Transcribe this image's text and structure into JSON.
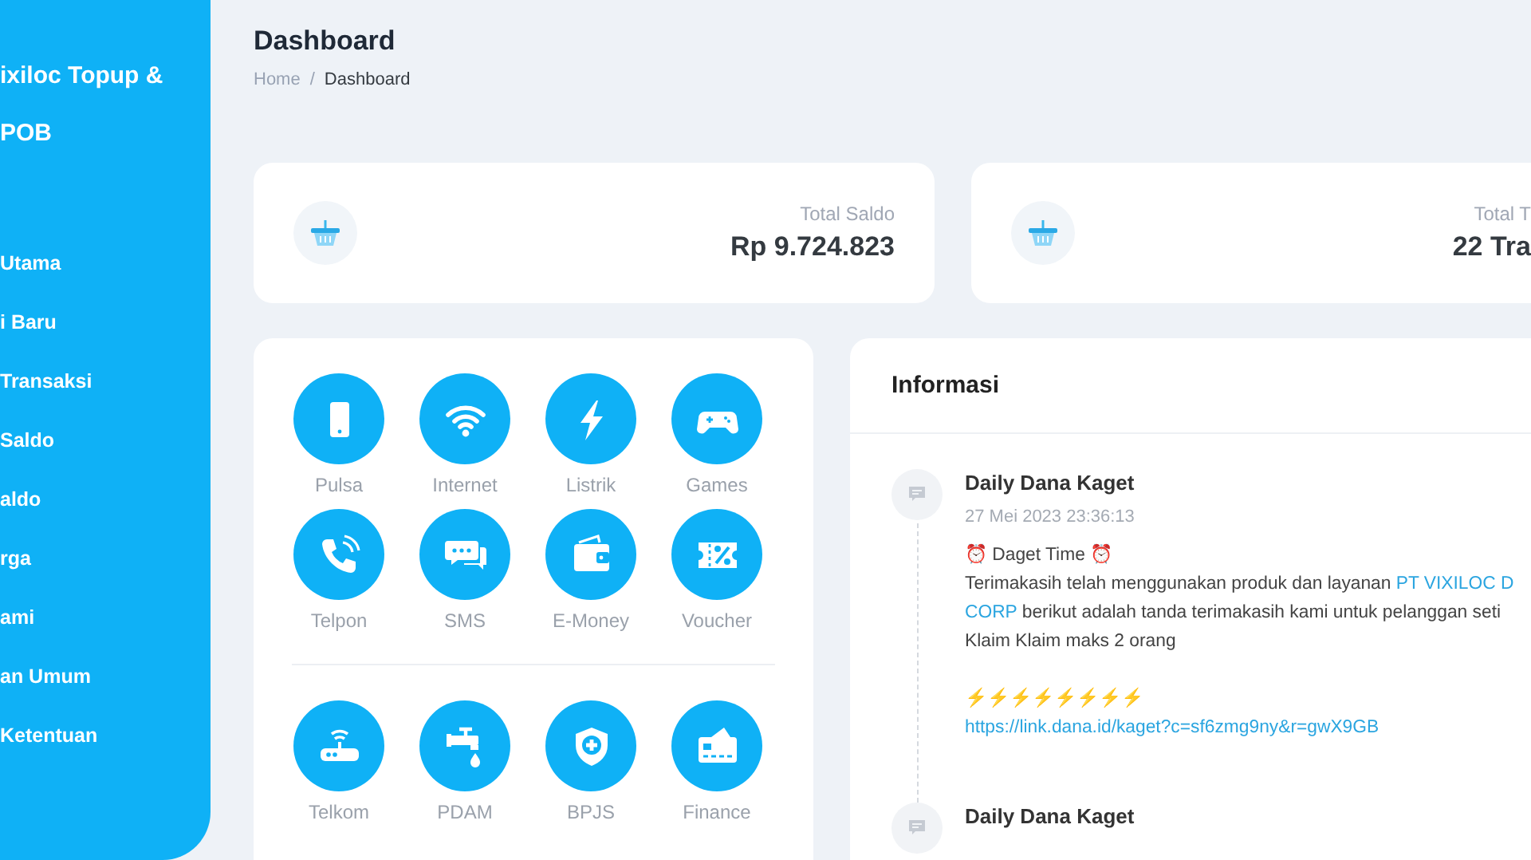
{
  "sidebar": {
    "brand_lines": [
      "ixiloc Topup &",
      "POB"
    ],
    "items": [
      "Utama",
      "i Baru",
      "Transaksi",
      "Saldo",
      "aldo",
      "rga",
      "ami",
      "an Umum",
      "Ketentuan"
    ]
  },
  "header": {
    "title": "Dashboard",
    "separator": "/",
    "breadcrumb": [
      {
        "label": "Home",
        "selected": false
      },
      {
        "label": "Dashboard",
        "selected": true
      }
    ]
  },
  "stats": [
    {
      "label": "Total Saldo",
      "value": "Rp 9.724.823"
    },
    {
      "label": "Total T",
      "value": "22 Tra"
    }
  ],
  "services": {
    "groups": [
      [
        "Pulsa",
        "Internet",
        "Listrik",
        "Games",
        "Telpon",
        "SMS",
        "E-Money",
        "Voucher"
      ],
      [
        "Telkom",
        "PDAM",
        "BPJS",
        "Finance"
      ]
    ]
  },
  "info": {
    "title": "Informasi",
    "posts": [
      {
        "title": "Daily Dana Kaget",
        "date": "27 Mei 2023 23:36:13",
        "paragraphs": [
          [
            [
              {
                "text": "⏰ Daget Time ⏰",
                "link": false
              }
            ],
            [
              {
                "text": "Terimakasih telah menggunakan produk dan layanan ",
                "link": false
              },
              {
                "text": "PT VIXILOC D",
                "link": true
              }
            ],
            [
              {
                "text": "CORP",
                "link": true
              },
              {
                "text": " berikut adalah tanda terimakasih kami untuk pelanggan seti",
                "link": false
              }
            ],
            [
              {
                "text": "Klaim Klaim maks 2 orang",
                "link": false
              }
            ]
          ],
          [
            [
              {
                "text": "⚡⚡⚡⚡⚡⚡⚡⚡"
              }
            ],
            [
              {
                "text": "https://link.dana.id/kaget?c=sf6zmg9ny&r=gwX9GB",
                "link": true
              }
            ]
          ]
        ]
      },
      {
        "title": "Daily Dana Kaget"
      }
    ]
  }
}
